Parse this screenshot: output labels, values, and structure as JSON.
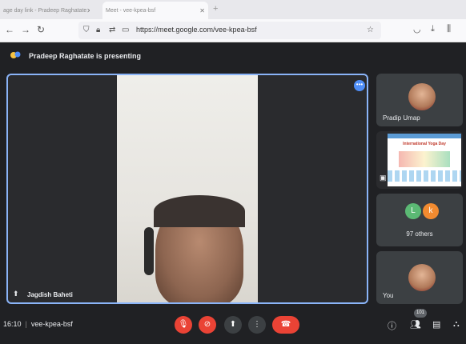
{
  "browser": {
    "tabs": [
      {
        "title": "age day link - Pradeep Raghatate"
      },
      {
        "title": "Meet - vee-kpea-bsf"
      }
    ],
    "url": "https://meet.google.com/vee-kpea-bsf"
  },
  "meet": {
    "presenting_text": "Pradeep Raghatate is presenting",
    "main_speaker": "Jagdish Baheti",
    "participants": [
      {
        "name": "Pradip Umap"
      },
      {
        "name": "You"
      }
    ],
    "others": {
      "avatars": [
        {
          "letter": "L",
          "color": "#5bb974"
        },
        {
          "letter": "k",
          "color": "#f28b30"
        }
      ],
      "label": "97 others"
    },
    "presentation_thumb_title": "International Yoga Day",
    "time": "16:10",
    "meeting_code": "vee-kpea-bsf",
    "people_count": "101"
  },
  "colors": {
    "accent": "#8ab4f8",
    "danger": "#ea4335",
    "surface": "#3c4043"
  }
}
